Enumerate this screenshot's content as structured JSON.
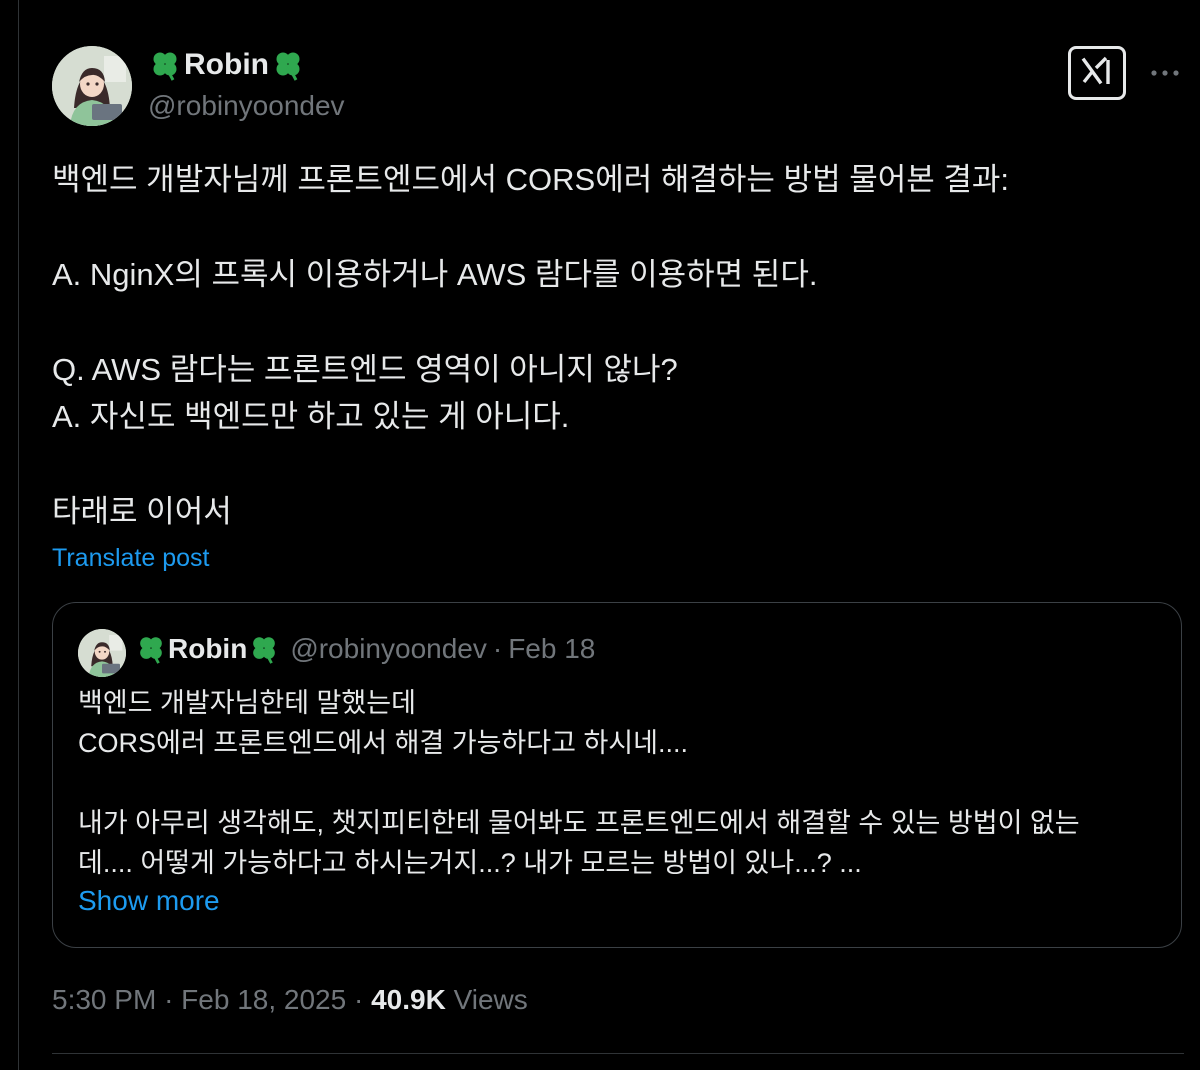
{
  "author": {
    "display_name": "Robin",
    "handle": "@robinyoondev"
  },
  "post": {
    "lines": [
      "백엔드 개발자님께 프론트엔드에서 CORS에러 해결하는 방법 물어본 결과:",
      "",
      "A. NginX의 프록시 이용하거나 AWS 람다를 이용하면 된다.",
      "",
      "Q. AWS 람다는 프론트엔드 영역이 아니지 않나?",
      "A. 자신도 백엔드만 하고 있는 게 아니다.",
      "",
      "타래로 이어서"
    ],
    "translate_label": "Translate post"
  },
  "quoted_post": {
    "display_name": "Robin",
    "handle": "@robinyoondev",
    "separator": "·",
    "date": "Feb 18",
    "lines": [
      "백엔드 개발자님한테 말했는데",
      "CORS에러 프론트엔드에서 해결 가능하다고 하시네....",
      "",
      "내가 아무리 생각해도, 챗지피티한테 물어봐도 프론트엔드에서 해결할 수 있는 방법이 없는",
      "데.... 어떻게 가능하다고 하시는거지...? 내가 모르는 방법이 있나...? ..."
    ],
    "show_more_label": "Show more"
  },
  "meta": {
    "time": "5:30 PM",
    "separator": "·",
    "date": "Feb 18, 2025",
    "views_count": "40.9K",
    "views_label": "Views"
  },
  "icons": {
    "grok": "grok-icon",
    "more": "more-dots-icon",
    "clover": "clover-emoji-icon"
  },
  "colors": {
    "background": "#000000",
    "text": "#e7e9ea",
    "secondary": "#71767b",
    "link": "#1d9bf0",
    "clover": "#2fa84f",
    "border": "#2f3336"
  }
}
